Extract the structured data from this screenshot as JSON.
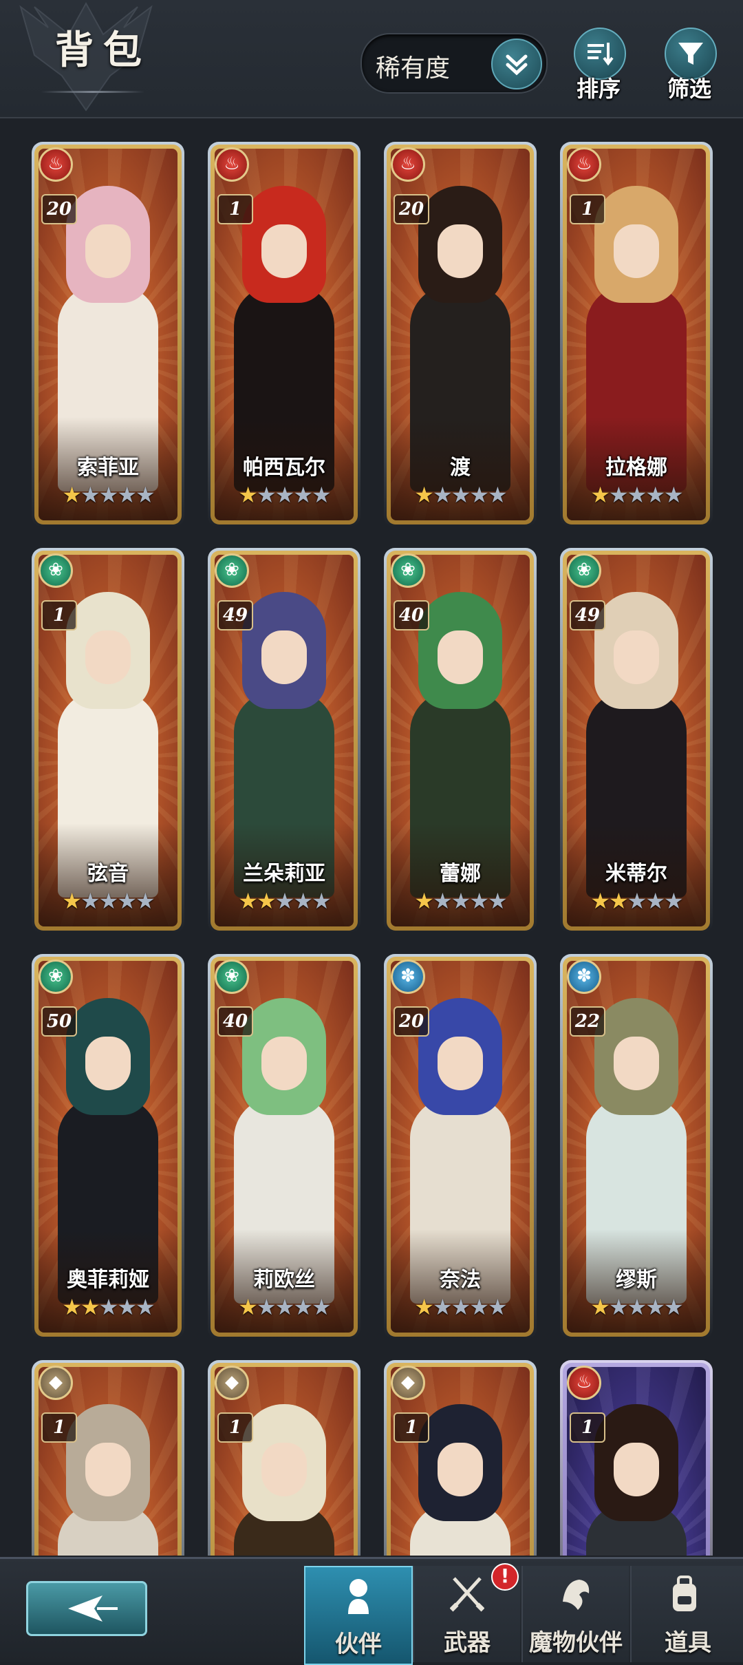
{
  "header": {
    "title": "背包",
    "sort_select": {
      "value": "稀有度"
    },
    "sort_button_label": "排序",
    "filter_button_label": "筛选"
  },
  "cards": [
    {
      "name": "索菲亚",
      "level": "20",
      "element": "fire",
      "stars_filled": 1,
      "stars_total": 5,
      "hair": "#e6b4c0",
      "outfit": "#efe7dc"
    },
    {
      "name": "帕西瓦尔",
      "level": "1",
      "element": "fire",
      "stars_filled": 1,
      "stars_total": 5,
      "hair": "#c82a1e",
      "outfit": "#1a1414"
    },
    {
      "name": "渡",
      "level": "20",
      "element": "fire",
      "stars_filled": 1,
      "stars_total": 5,
      "hair": "#2a1c16",
      "outfit": "#24201e"
    },
    {
      "name": "拉格娜",
      "level": "1",
      "element": "fire",
      "stars_filled": 1,
      "stars_total": 5,
      "hair": "#d8a86a",
      "outfit": "#8a1c1e"
    },
    {
      "name": "弦音",
      "level": "1",
      "element": "wind",
      "stars_filled": 1,
      "stars_total": 5,
      "hair": "#e8e2cc",
      "outfit": "#f2ece0"
    },
    {
      "name": "兰朵莉亚",
      "level": "49",
      "element": "wind",
      "stars_filled": 2,
      "stars_total": 5,
      "hair": "#4a4a86",
      "outfit": "#2c4a3a"
    },
    {
      "name": "蕾娜",
      "level": "40",
      "element": "wind",
      "stars_filled": 1,
      "stars_total": 5,
      "hair": "#3f8a4c",
      "outfit": "#2a3a28"
    },
    {
      "name": "米蒂尔",
      "level": "49",
      "element": "wind",
      "stars_filled": 2,
      "stars_total": 5,
      "hair": "#e0cfb6",
      "outfit": "#1e1a1e"
    },
    {
      "name": "奥菲莉娅",
      "level": "50",
      "element": "wind",
      "stars_filled": 2,
      "stars_total": 5,
      "hair": "#1f4a4a",
      "outfit": "#1a1c22"
    },
    {
      "name": "莉欧丝",
      "level": "40",
      "element": "wind",
      "stars_filled": 1,
      "stars_total": 5,
      "hair": "#7ebf80",
      "outfit": "#e8e6de"
    },
    {
      "name": "奈法",
      "level": "20",
      "element": "water",
      "stars_filled": 1,
      "stars_total": 5,
      "hair": "#3848a8",
      "outfit": "#e6ded0"
    },
    {
      "name": "缪斯",
      "level": "22",
      "element": "water",
      "stars_filled": 1,
      "stars_total": 5,
      "hair": "#8a8a62",
      "outfit": "#d8e4e0"
    },
    {
      "name": "",
      "level": "1",
      "element": "earth",
      "stars_filled": 0,
      "stars_total": 0,
      "hair": "#b8ab98",
      "outfit": "#d8d0c2"
    },
    {
      "name": "",
      "level": "1",
      "element": "earth",
      "stars_filled": 0,
      "stars_total": 0,
      "hair": "#e8e0c8",
      "outfit": "#3a2a1a"
    },
    {
      "name": "",
      "level": "1",
      "element": "earth",
      "stars_filled": 0,
      "stars_total": 0,
      "hair": "#1e2232",
      "outfit": "#e8e2d4"
    },
    {
      "name": "",
      "level": "1",
      "element": "fire",
      "stars_filled": 0,
      "stars_total": 0,
      "hair": "#2a1a14",
      "outfit": "#2c3036",
      "variant": "purple"
    }
  ],
  "bottom_nav": {
    "tabs": [
      {
        "label": "伙伴",
        "icon": "partner-icon",
        "active": true
      },
      {
        "label": "武器",
        "icon": "swords-icon",
        "badge": "!"
      },
      {
        "label": "魔物伙伴",
        "icon": "monster-icon"
      },
      {
        "label": "道具",
        "icon": "backpack-icon"
      }
    ]
  },
  "colors": {
    "fire": "#c8261c",
    "wind": "#1f9a6a",
    "water": "#2f86c0",
    "earth": "#8a7656",
    "star_on": "#f5c64a",
    "star_off": "#a8b4c4"
  }
}
